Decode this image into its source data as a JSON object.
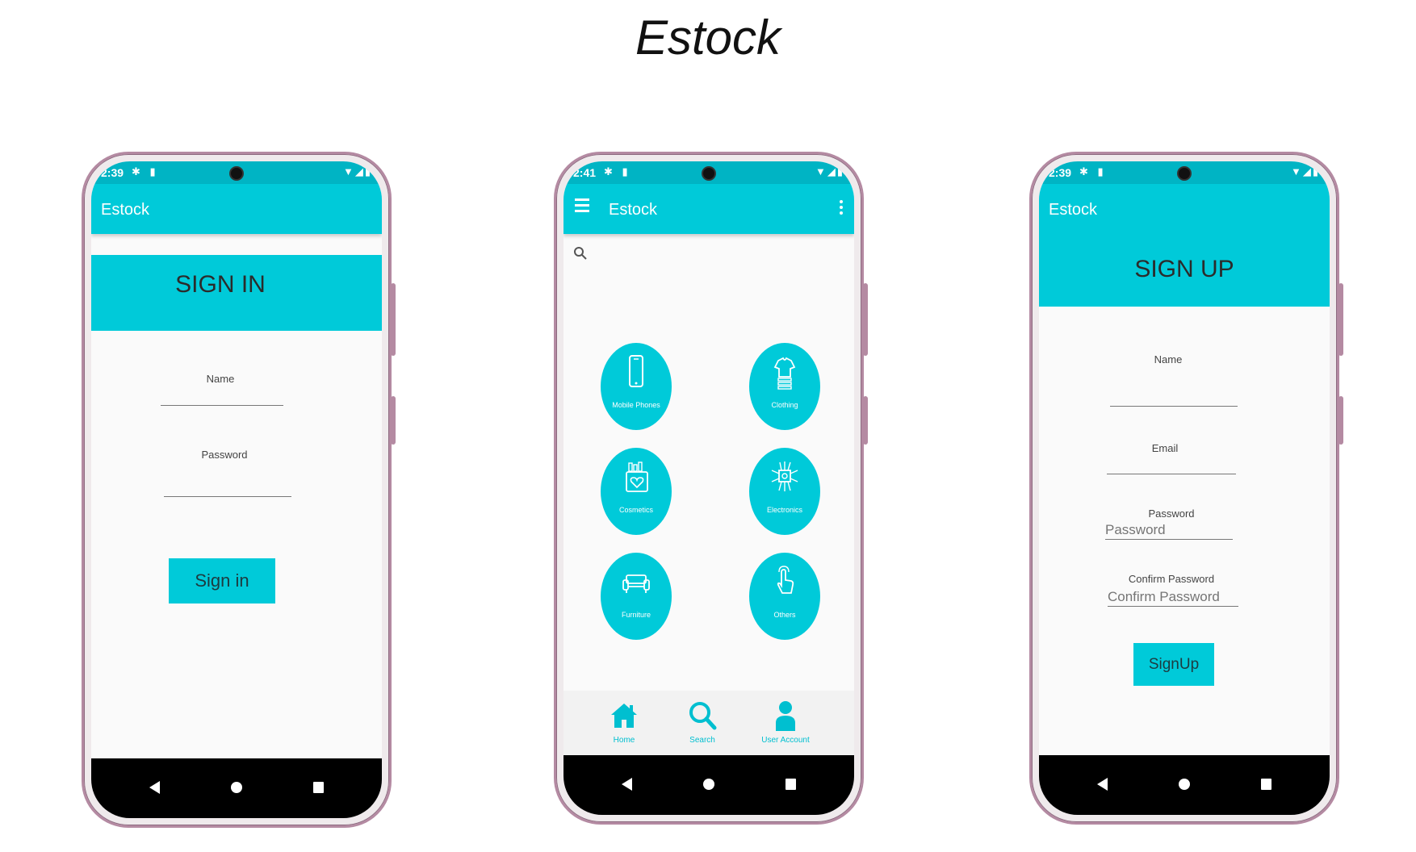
{
  "page": {
    "title": "Estock"
  },
  "colors": {
    "accent": "#00cad9",
    "status_bar": "#00b4c4",
    "nav_bar": "#000000",
    "frame": "#b48aa2"
  },
  "signin": {
    "status": {
      "time": "2:39"
    },
    "appbar_title": "Estock",
    "banner": "SIGN IN",
    "name_label": "Name",
    "password_label": "Password",
    "button": "Sign in"
  },
  "home": {
    "status": {
      "time": "2:41"
    },
    "appbar_title": "Estock",
    "categories": [
      {
        "label": "Mobile Phones",
        "icon": "mobile-phone-icon"
      },
      {
        "label": "Clothing",
        "icon": "clothing-icon"
      },
      {
        "label": "Cosmetics",
        "icon": "cosmetics-icon"
      },
      {
        "label": "Electronics",
        "icon": "electronics-icon"
      },
      {
        "label": "Furniture",
        "icon": "furniture-icon"
      },
      {
        "label": "Others",
        "icon": "others-icon"
      }
    ],
    "bottom_nav": [
      {
        "label": "Home",
        "icon": "home-icon"
      },
      {
        "label": "Search",
        "icon": "search-icon"
      },
      {
        "label": "User Account",
        "icon": "user-icon"
      }
    ]
  },
  "signup": {
    "status": {
      "time": "2:39"
    },
    "appbar_title": "Estock",
    "banner": "SIGN UP",
    "name_label": "Name",
    "email_label": "Email",
    "password_label": "Password",
    "password_placeholder": "Password",
    "confirm_label": "Confirm Password",
    "confirm_placeholder": "Confirm Password",
    "button": "SignUp"
  }
}
